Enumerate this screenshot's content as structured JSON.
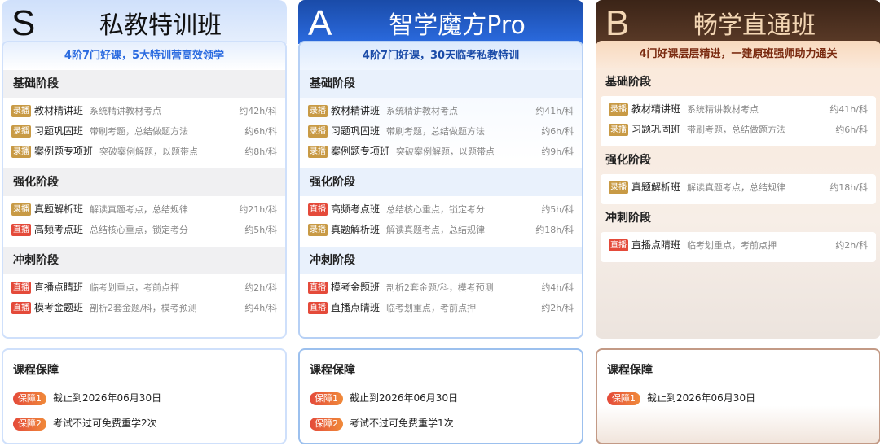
{
  "columns": [
    {
      "letter": "S",
      "title": "私教特训班",
      "tagline": "4阶7门好课，5大特训营高效领学",
      "stages": [
        {
          "name": "基础阶段",
          "courses": [
            {
              "badge": "录播",
              "type": "rec",
              "name": "教材精讲班",
              "desc": "系统精讲教材考点",
              "dur": "约42h/科"
            },
            {
              "badge": "录播",
              "type": "rec",
              "name": "习题巩固班",
              "desc": "带刷考题，总结做题方法",
              "dur": "约6h/科"
            },
            {
              "badge": "录播",
              "type": "rec",
              "name": "案例题专项班",
              "desc": "突破案例解题，以题带点",
              "dur": "约8h/科"
            }
          ]
        },
        {
          "name": "强化阶段",
          "courses": [
            {
              "badge": "录播",
              "type": "rec",
              "name": "真题解析班",
              "desc": "解读真题考点，总结规律",
              "dur": "约21h/科"
            },
            {
              "badge": "直播",
              "type": "live",
              "name": "高频考点班",
              "desc": "总结核心重点，锁定考分",
              "dur": "约5h/科"
            }
          ]
        },
        {
          "name": "冲刺阶段",
          "courses": [
            {
              "badge": "直播",
              "type": "live",
              "name": "直播点睛班",
              "desc": "临考划重点，考前点押",
              "dur": "约2h/科"
            },
            {
              "badge": "直播",
              "type": "live",
              "name": "模考金题班",
              "desc": "剖析2套金题/科，模考预测",
              "dur": "约4h/科"
            }
          ]
        }
      ],
      "guarantee": {
        "title": "课程保障",
        "items": [
          {
            "badge": "保障1",
            "text": "截止到2026年06月30日"
          },
          {
            "badge": "保障2",
            "text": "考试不过可免费重学2次"
          }
        ]
      }
    },
    {
      "letter": "A",
      "title": "智学魔方Pro",
      "tagline": "4阶7门好课，30天临考私教特训",
      "stages": [
        {
          "name": "基础阶段",
          "courses": [
            {
              "badge": "录播",
              "type": "rec",
              "name": "教材精讲班",
              "desc": "系统精讲教材考点",
              "dur": "约41h/科"
            },
            {
              "badge": "录播",
              "type": "rec",
              "name": "习题巩固班",
              "desc": "带刷考题，总结做题方法",
              "dur": "约6h/科"
            },
            {
              "badge": "录播",
              "type": "rec",
              "name": "案例题专项班",
              "desc": "突破案例解题，以题带点",
              "dur": "约9h/科"
            }
          ]
        },
        {
          "name": "强化阶段",
          "courses": [
            {
              "badge": "直播",
              "type": "live",
              "name": "高频考点班",
              "desc": "总结核心重点，锁定考分",
              "dur": "约5h/科"
            },
            {
              "badge": "录播",
              "type": "rec",
              "name": "真题解析班",
              "desc": "解读真题考点，总结规律",
              "dur": "约18h/科"
            }
          ]
        },
        {
          "name": "冲刺阶段",
          "courses": [
            {
              "badge": "直播",
              "type": "live",
              "name": "模考金题班",
              "desc": "剖析2套金题/科，模考预测",
              "dur": "约4h/科"
            },
            {
              "badge": "直播",
              "type": "live",
              "name": "直播点睛班",
              "desc": "临考划重点，考前点押",
              "dur": "约2h/科"
            }
          ]
        }
      ],
      "guarantee": {
        "title": "课程保障",
        "items": [
          {
            "badge": "保障1",
            "text": "截止到2026年06月30日"
          },
          {
            "badge": "保障2",
            "text": "考试不过可免费重学1次"
          }
        ]
      }
    },
    {
      "letter": "B",
      "title": "畅学直通班",
      "tagline": "4门好课层层精进，一建原班强师助力通关",
      "stages": [
        {
          "name": "基础阶段",
          "courses": [
            {
              "badge": "录播",
              "type": "rec",
              "name": "教材精讲班",
              "desc": "系统精讲教材考点",
              "dur": "约41h/科"
            },
            {
              "badge": "录播",
              "type": "rec",
              "name": "习题巩固班",
              "desc": "带刷考题，总结做题方法",
              "dur": "约6h/科"
            }
          ]
        },
        {
          "name": "强化阶段",
          "courses": [
            {
              "badge": "录播",
              "type": "rec",
              "name": "真题解析班",
              "desc": "解读真题考点，总结规律",
              "dur": "约18h/科"
            }
          ]
        },
        {
          "name": "冲刺阶段",
          "courses": [
            {
              "badge": "直播",
              "type": "live",
              "name": "直播点睛班",
              "desc": "临考划重点，考前点押",
              "dur": "约2h/科"
            }
          ]
        }
      ],
      "guarantee": {
        "title": "课程保障",
        "items": [
          {
            "badge": "保障1",
            "text": "截止到2026年06月30日"
          }
        ]
      }
    }
  ]
}
